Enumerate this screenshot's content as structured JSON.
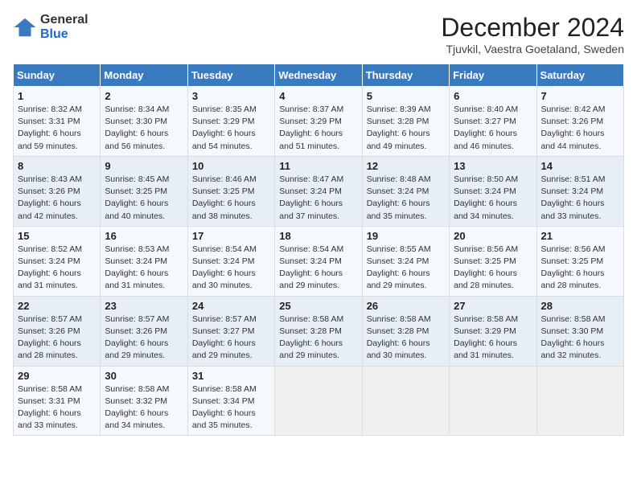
{
  "logo": {
    "general": "General",
    "blue": "Blue"
  },
  "title": "December 2024",
  "subtitle": "Tjuvkil, Vaestra Goetaland, Sweden",
  "days_header": [
    "Sunday",
    "Monday",
    "Tuesday",
    "Wednesday",
    "Thursday",
    "Friday",
    "Saturday"
  ],
  "weeks": [
    [
      {
        "day": "1",
        "sunrise": "Sunrise: 8:32 AM",
        "sunset": "Sunset: 3:31 PM",
        "daylight": "Daylight: 6 hours and 59 minutes."
      },
      {
        "day": "2",
        "sunrise": "Sunrise: 8:34 AM",
        "sunset": "Sunset: 3:30 PM",
        "daylight": "Daylight: 6 hours and 56 minutes."
      },
      {
        "day": "3",
        "sunrise": "Sunrise: 8:35 AM",
        "sunset": "Sunset: 3:29 PM",
        "daylight": "Daylight: 6 hours and 54 minutes."
      },
      {
        "day": "4",
        "sunrise": "Sunrise: 8:37 AM",
        "sunset": "Sunset: 3:29 PM",
        "daylight": "Daylight: 6 hours and 51 minutes."
      },
      {
        "day": "5",
        "sunrise": "Sunrise: 8:39 AM",
        "sunset": "Sunset: 3:28 PM",
        "daylight": "Daylight: 6 hours and 49 minutes."
      },
      {
        "day": "6",
        "sunrise": "Sunrise: 8:40 AM",
        "sunset": "Sunset: 3:27 PM",
        "daylight": "Daylight: 6 hours and 46 minutes."
      },
      {
        "day": "7",
        "sunrise": "Sunrise: 8:42 AM",
        "sunset": "Sunset: 3:26 PM",
        "daylight": "Daylight: 6 hours and 44 minutes."
      }
    ],
    [
      {
        "day": "8",
        "sunrise": "Sunrise: 8:43 AM",
        "sunset": "Sunset: 3:26 PM",
        "daylight": "Daylight: 6 hours and 42 minutes."
      },
      {
        "day": "9",
        "sunrise": "Sunrise: 8:45 AM",
        "sunset": "Sunset: 3:25 PM",
        "daylight": "Daylight: 6 hours and 40 minutes."
      },
      {
        "day": "10",
        "sunrise": "Sunrise: 8:46 AM",
        "sunset": "Sunset: 3:25 PM",
        "daylight": "Daylight: 6 hours and 38 minutes."
      },
      {
        "day": "11",
        "sunrise": "Sunrise: 8:47 AM",
        "sunset": "Sunset: 3:24 PM",
        "daylight": "Daylight: 6 hours and 37 minutes."
      },
      {
        "day": "12",
        "sunrise": "Sunrise: 8:48 AM",
        "sunset": "Sunset: 3:24 PM",
        "daylight": "Daylight: 6 hours and 35 minutes."
      },
      {
        "day": "13",
        "sunrise": "Sunrise: 8:50 AM",
        "sunset": "Sunset: 3:24 PM",
        "daylight": "Daylight: 6 hours and 34 minutes."
      },
      {
        "day": "14",
        "sunrise": "Sunrise: 8:51 AM",
        "sunset": "Sunset: 3:24 PM",
        "daylight": "Daylight: 6 hours and 33 minutes."
      }
    ],
    [
      {
        "day": "15",
        "sunrise": "Sunrise: 8:52 AM",
        "sunset": "Sunset: 3:24 PM",
        "daylight": "Daylight: 6 hours and 31 minutes."
      },
      {
        "day": "16",
        "sunrise": "Sunrise: 8:53 AM",
        "sunset": "Sunset: 3:24 PM",
        "daylight": "Daylight: 6 hours and 31 minutes."
      },
      {
        "day": "17",
        "sunrise": "Sunrise: 8:54 AM",
        "sunset": "Sunset: 3:24 PM",
        "daylight": "Daylight: 6 hours and 30 minutes."
      },
      {
        "day": "18",
        "sunrise": "Sunrise: 8:54 AM",
        "sunset": "Sunset: 3:24 PM",
        "daylight": "Daylight: 6 hours and 29 minutes."
      },
      {
        "day": "19",
        "sunrise": "Sunrise: 8:55 AM",
        "sunset": "Sunset: 3:24 PM",
        "daylight": "Daylight: 6 hours and 29 minutes."
      },
      {
        "day": "20",
        "sunrise": "Sunrise: 8:56 AM",
        "sunset": "Sunset: 3:25 PM",
        "daylight": "Daylight: 6 hours and 28 minutes."
      },
      {
        "day": "21",
        "sunrise": "Sunrise: 8:56 AM",
        "sunset": "Sunset: 3:25 PM",
        "daylight": "Daylight: 6 hours and 28 minutes."
      }
    ],
    [
      {
        "day": "22",
        "sunrise": "Sunrise: 8:57 AM",
        "sunset": "Sunset: 3:26 PM",
        "daylight": "Daylight: 6 hours and 28 minutes."
      },
      {
        "day": "23",
        "sunrise": "Sunrise: 8:57 AM",
        "sunset": "Sunset: 3:26 PM",
        "daylight": "Daylight: 6 hours and 29 minutes."
      },
      {
        "day": "24",
        "sunrise": "Sunrise: 8:57 AM",
        "sunset": "Sunset: 3:27 PM",
        "daylight": "Daylight: 6 hours and 29 minutes."
      },
      {
        "day": "25",
        "sunrise": "Sunrise: 8:58 AM",
        "sunset": "Sunset: 3:28 PM",
        "daylight": "Daylight: 6 hours and 29 minutes."
      },
      {
        "day": "26",
        "sunrise": "Sunrise: 8:58 AM",
        "sunset": "Sunset: 3:28 PM",
        "daylight": "Daylight: 6 hours and 30 minutes."
      },
      {
        "day": "27",
        "sunrise": "Sunrise: 8:58 AM",
        "sunset": "Sunset: 3:29 PM",
        "daylight": "Daylight: 6 hours and 31 minutes."
      },
      {
        "day": "28",
        "sunrise": "Sunrise: 8:58 AM",
        "sunset": "Sunset: 3:30 PM",
        "daylight": "Daylight: 6 hours and 32 minutes."
      }
    ],
    [
      {
        "day": "29",
        "sunrise": "Sunrise: 8:58 AM",
        "sunset": "Sunset: 3:31 PM",
        "daylight": "Daylight: 6 hours and 33 minutes."
      },
      {
        "day": "30",
        "sunrise": "Sunrise: 8:58 AM",
        "sunset": "Sunset: 3:32 PM",
        "daylight": "Daylight: 6 hours and 34 minutes."
      },
      {
        "day": "31",
        "sunrise": "Sunrise: 8:58 AM",
        "sunset": "Sunset: 3:34 PM",
        "daylight": "Daylight: 6 hours and 35 minutes."
      },
      null,
      null,
      null,
      null
    ]
  ]
}
